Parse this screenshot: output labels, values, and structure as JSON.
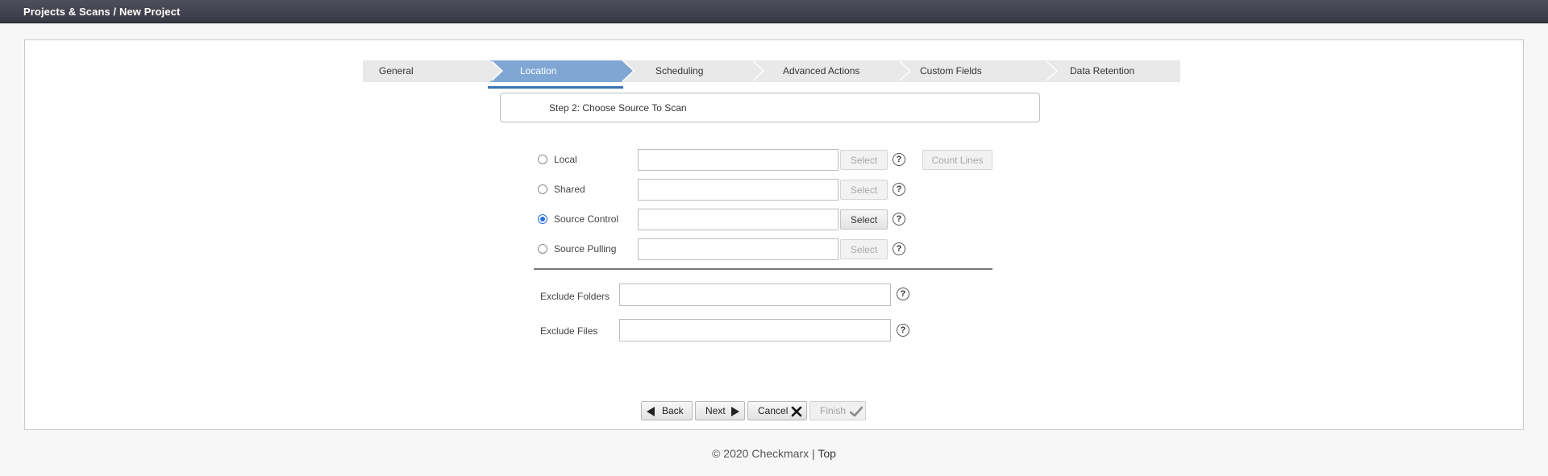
{
  "header": {
    "breadcrumb": "Projects & Scans / New Project"
  },
  "steps": [
    {
      "label": "General",
      "active": false
    },
    {
      "label": "Location",
      "active": true
    },
    {
      "label": "Scheduling",
      "active": false
    },
    {
      "label": "Advanced Actions",
      "active": false
    },
    {
      "label": "Custom Fields",
      "active": false
    },
    {
      "label": "Data Retention",
      "active": false
    }
  ],
  "step_title": "Step 2: Choose Source To Scan",
  "sources": [
    {
      "label": "Local",
      "selected": false,
      "select_label": "Select",
      "select_enabled": false,
      "value": ""
    },
    {
      "label": "Shared",
      "selected": false,
      "select_label": "Select",
      "select_enabled": false,
      "value": ""
    },
    {
      "label": "Source Control",
      "selected": true,
      "select_label": "Select",
      "select_enabled": true,
      "value": ""
    },
    {
      "label": "Source Pulling",
      "selected": false,
      "select_label": "Select",
      "select_enabled": false,
      "value": ""
    }
  ],
  "count_lines_label": "Count Lines",
  "help_glyph": "?",
  "exclude_folders": {
    "label": "Exclude Folders",
    "value": ""
  },
  "exclude_files": {
    "label": "Exclude Files",
    "value": ""
  },
  "nav": {
    "back": "Back",
    "next": "Next",
    "cancel": "Cancel",
    "finish": "Finish"
  },
  "footer": {
    "copyright": "© 2020 Checkmarx",
    "separator": "|",
    "top_link": "Top"
  },
  "colors": {
    "accent": "#80a7d4",
    "underline": "#3b72b6",
    "topbar": "#393944"
  }
}
